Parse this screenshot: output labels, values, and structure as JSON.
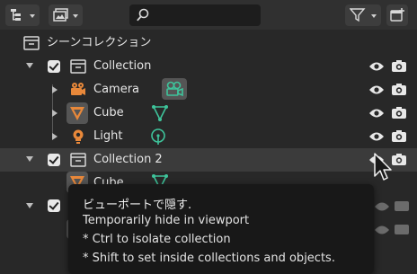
{
  "header": {
    "display_mode_icon": "outliner-icon",
    "filter_icon": "funnel-icon",
    "new_collection_icon": "new-collection-icon",
    "search": {
      "value": "",
      "placeholder": ""
    }
  },
  "tree": {
    "scene_collection": {
      "label": "シーンコレクション"
    },
    "rows": [
      {
        "label": "Collection",
        "type": "collection"
      },
      {
        "label": "Camera",
        "type": "camera"
      },
      {
        "label": "Cube",
        "type": "mesh"
      },
      {
        "label": "Light",
        "type": "light"
      },
      {
        "label": "Collection 2",
        "type": "collection"
      },
      {
        "label": "Cube",
        "type": "mesh"
      }
    ]
  },
  "tooltip": {
    "title": "ビューポートで隠す.",
    "lines": [
      "Temporarily hide in viewport",
      "* Ctrl to isolate collection",
      "* Shift to set inside collections and objects."
    ]
  },
  "colors": {
    "background": "#282828",
    "header": "#303030",
    "selected_row": "#3b3b3b",
    "object_orange": "#e8883a",
    "data_green": "#3ec49b"
  }
}
